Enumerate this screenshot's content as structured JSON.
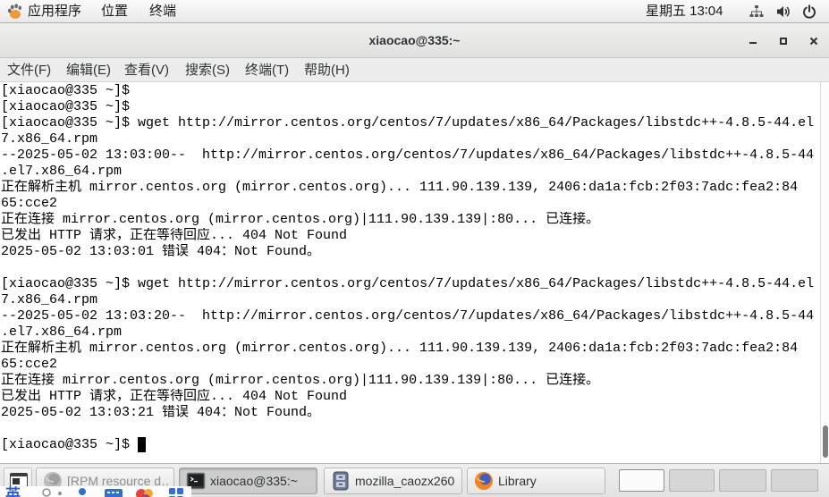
{
  "colors": {
    "panel_bg": "#e9e9e9",
    "terminal_bg": "#ffffff",
    "terminal_fg": "#000000",
    "scrollbar_thumb": "#7f7f7f",
    "active_task_bg": "#cdcdcd",
    "active_workspace_bg": "#fbfbfb"
  },
  "top_panel": {
    "applications_menu": {
      "label": "应用程序",
      "icon": "gnome-foot-icon"
    },
    "places_menu": {
      "label": "位置"
    },
    "app_menu": {
      "label": "终端"
    },
    "clock": "星期五 13∶04",
    "status_icons": [
      "network-wired-icon",
      "volume-icon",
      "power-icon"
    ]
  },
  "window": {
    "title": "xiaocao@335:~",
    "controls": [
      "minimize-icon",
      "maximize-icon",
      "close-icon"
    ],
    "menu": [
      "文件(F)",
      "编辑(E)",
      "查看(V)",
      "搜索(S)",
      "终端(T)",
      "帮助(H)"
    ]
  },
  "terminal": {
    "lines": [
      "[xiaocao@335 ~]$",
      "[xiaocao@335 ~]$",
      "[xiaocao@335 ~]$ wget http://mirror.centos.org/centos/7/updates/x86_64/Packages/libstdc++-4.8.5-44.el",
      "7.x86_64.rpm",
      "--2025-05-02 13:03:00--  http://mirror.centos.org/centos/7/updates/x86_64/Packages/libstdc++-4.8.5-44",
      ".el7.x86_64.rpm",
      "正在解析主机 mirror.centos.org (mirror.centos.org)... 111.90.139.139, 2406:da1a:fcb:2f03:7adc:fea2:84",
      "65:cce2",
      "正在连接 mirror.centos.org (mirror.centos.org)|111.90.139.139|:80... 已连接。",
      "已发出 HTTP 请求，正在等待回应... 404 Not Found",
      "2025-05-02 13:03:01 错误 404：Not Found。",
      "",
      "[xiaocao@335 ~]$ wget http://mirror.centos.org/centos/7/updates/x86_64/Packages/libstdc++-4.8.5-44.el",
      "7.x86_64.rpm",
      "--2025-05-02 13:03:20--  http://mirror.centos.org/centos/7/updates/x86_64/Packages/libstdc++-4.8.5-44",
      ".el7.x86_64.rpm",
      "正在解析主机 mirror.centos.org (mirror.centos.org)... 111.90.139.139, 2406:da1a:fcb:2f03:7adc:fea2:84",
      "65:cce2",
      "正在连接 mirror.centos.org (mirror.centos.org)|111.90.139.139|:80... 已连接。",
      "已发出 HTTP 请求，正在等待回应... 404 Not Found",
      "2025-05-02 13:03:21 错误 404：Not Found。",
      "",
      "[xiaocao@335 ~]$ "
    ],
    "scroll_fraction": 1.0
  },
  "taskbar": {
    "show_desktop_icon": "show-desktop-icon",
    "tasks": [
      {
        "label": "[RPM resource d…",
        "icon": "firefox-icon",
        "active": false,
        "minimized": true
      },
      {
        "label": "xiaocao@335:~",
        "icon": "terminal-icon",
        "active": true,
        "minimized": false
      },
      {
        "label": "mozilla_caozx260",
        "icon": "file-cabinet-icon",
        "active": false,
        "minimized": false
      },
      {
        "label": "Library",
        "icon": "firefox-icon",
        "active": false,
        "minimized": false
      }
    ],
    "workspaces": {
      "count": 4,
      "active_index": 0
    }
  },
  "input_method": {
    "mode_label": "英",
    "icons": [
      "punctuation-icon",
      "dot-icon",
      "user-icon",
      "keyboard-icon",
      "skin-icon",
      "toolbox-icon"
    ]
  }
}
